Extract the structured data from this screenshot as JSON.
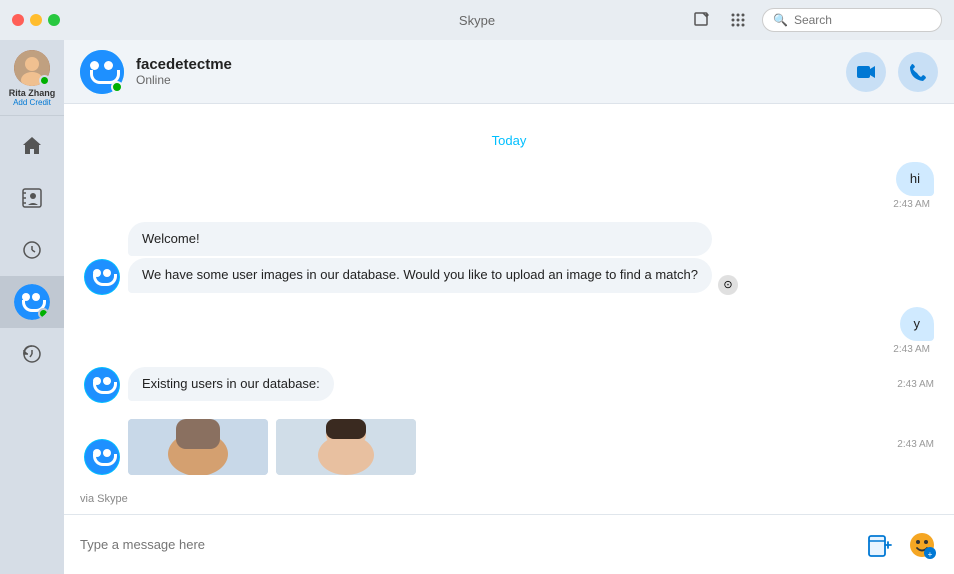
{
  "titlebar": {
    "title": "Skype",
    "buttons": {
      "close": "●",
      "min": "●",
      "max": "●"
    }
  },
  "toolbar": {
    "compose_icon": "✎",
    "dialpad_icon": "⠿",
    "search_placeholder": "Search"
  },
  "sidebar": {
    "user": {
      "name": "Rita Zhang",
      "add_credit": "Add Credit",
      "status": "online"
    },
    "nav_items": [
      {
        "id": "home",
        "icon": "⌂",
        "label": "Home"
      },
      {
        "id": "contacts",
        "icon": "👤",
        "label": "Contacts"
      },
      {
        "id": "recent",
        "icon": "🕐",
        "label": "Recent"
      },
      {
        "id": "active-chat",
        "label": "Active Chat",
        "isUser": true
      },
      {
        "id": "history",
        "icon": "🕐",
        "label": "History"
      }
    ]
  },
  "chat": {
    "contact_name": "facedetectme",
    "contact_status": "Online",
    "date_label": "Today",
    "messages": [
      {
        "id": "m1",
        "type": "outgoing",
        "text": "hi",
        "time": "2:43 AM"
      },
      {
        "id": "m2",
        "type": "incoming",
        "bubbles": [
          "Welcome!"
        ],
        "time": ""
      },
      {
        "id": "m3",
        "type": "incoming",
        "bubbles": [
          "We have some user images in our database. Would you like to upload an image to find a match?"
        ],
        "time": ""
      },
      {
        "id": "m4",
        "type": "outgoing",
        "text": "y",
        "time": "2:43 AM"
      },
      {
        "id": "m5",
        "type": "incoming",
        "bubbles": [
          "Existing users in our database:"
        ],
        "time": "2:43 AM"
      },
      {
        "id": "m6",
        "type": "incoming",
        "hasImages": true,
        "time": "2:43 AM"
      }
    ],
    "via_skype": "via Skype",
    "input_placeholder": "Type a message here"
  }
}
